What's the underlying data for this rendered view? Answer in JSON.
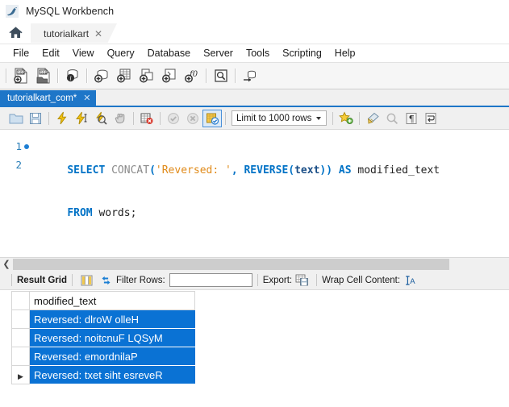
{
  "window": {
    "title": "MySQL Workbench",
    "logo_icon": "mysql-dolphin-icon"
  },
  "connection_tabs": {
    "home_icon": "home-icon",
    "tabs": [
      {
        "label": "tutorialkart",
        "close_icon": "close-icon"
      }
    ]
  },
  "menubar": {
    "items": [
      "File",
      "Edit",
      "View",
      "Query",
      "Database",
      "Server",
      "Tools",
      "Scripting",
      "Help"
    ]
  },
  "main_toolbar": {
    "buttons": [
      {
        "name": "new-sql-tab-icon",
        "glyph": "SQL"
      },
      {
        "name": "open-sql-script-icon",
        "glyph": "SQL"
      },
      {
        "name": "connection-info-icon",
        "glyph": "i"
      },
      {
        "name": "create-schema-icon",
        "glyph": "+"
      },
      {
        "name": "create-table-icon",
        "glyph": "+"
      },
      {
        "name": "create-view-icon",
        "glyph": "+"
      },
      {
        "name": "create-procedure-icon",
        "glyph": "+"
      },
      {
        "name": "create-function-icon",
        "glyph": "f0"
      },
      {
        "name": "search-data-icon",
        "glyph": "Q"
      },
      {
        "name": "reconnect-server-icon",
        "glyph": "~"
      }
    ]
  },
  "editor_tabs": {
    "tabs": [
      {
        "label": "tutorialkart_com*",
        "close_icon": "close-icon",
        "active": true
      }
    ]
  },
  "editor_toolbar": {
    "buttons": [
      {
        "name": "open-file-icon"
      },
      {
        "name": "save-file-icon"
      },
      {
        "name": "execute-statement-icon"
      },
      {
        "name": "execute-current-statement-icon"
      },
      {
        "name": "explain-statement-icon"
      },
      {
        "name": "stop-execution-icon"
      },
      {
        "name": "toggle-stop-on-error-icon"
      },
      {
        "name": "commit-transaction-icon"
      },
      {
        "name": "rollback-transaction-icon"
      },
      {
        "name": "toggle-auto-commit-icon"
      }
    ],
    "limit_dropdown": {
      "value": "Limit to 1000 rows",
      "caret_icon": "chevron-down-icon"
    },
    "right_buttons": [
      {
        "name": "save-snippet-icon"
      },
      {
        "name": "beautify-query-icon"
      },
      {
        "name": "find-icon"
      },
      {
        "name": "toggle-invisible-chars-icon"
      },
      {
        "name": "toggle-word-wrap-icon"
      }
    ]
  },
  "editor": {
    "lines": [
      {
        "number": "1",
        "has_breakpoint_dot": true,
        "tokens": [
          {
            "text": "    ",
            "type": "plain"
          },
          {
            "text": "SELECT",
            "type": "keyword"
          },
          {
            "text": " ",
            "type": "plain"
          },
          {
            "text": "CONCAT",
            "type": "function"
          },
          {
            "text": "(",
            "type": "punctuation"
          },
          {
            "text": "'Reversed: '",
            "type": "string"
          },
          {
            "text": ",",
            "type": "punctuation"
          },
          {
            "text": " ",
            "type": "plain"
          },
          {
            "text": "REVERSE",
            "type": "keyword"
          },
          {
            "text": "(",
            "type": "punctuation"
          },
          {
            "text": "text",
            "type": "column"
          },
          {
            "text": "))",
            "type": "punctuation"
          },
          {
            "text": " ",
            "type": "plain"
          },
          {
            "text": "AS",
            "type": "keyword"
          },
          {
            "text": " ",
            "type": "plain"
          },
          {
            "text": "modified_text",
            "type": "identifier"
          }
        ]
      },
      {
        "number": "2",
        "has_breakpoint_dot": false,
        "tokens": [
          {
            "text": "    ",
            "type": "plain"
          },
          {
            "text": "FROM",
            "type": "keyword"
          },
          {
            "text": " ",
            "type": "plain"
          },
          {
            "text": "words;",
            "type": "identifier"
          }
        ]
      }
    ]
  },
  "editor_scrollbar": {
    "left_arrow_icon": "chevron-left-icon"
  },
  "results_toolbar": {
    "result_grid_label": "Result Grid",
    "grid_view_icon": "grid-view-icon",
    "refresh_icon": "refresh-icon",
    "filter_label": "Filter Rows:",
    "filter_value": "",
    "filter_placeholder": "",
    "export_label": "Export:",
    "export_icon": "export-recordset-icon",
    "wrap_label": "Wrap Cell Content:",
    "wrap_icon": "wrap-cell-content-icon"
  },
  "result_grid": {
    "columns": [
      "modified_text"
    ],
    "rows": [
      {
        "marker": "",
        "modified_text": "Reversed: dlroW olleH",
        "selected": true
      },
      {
        "marker": "",
        "modified_text": "Reversed: noitcnuF LQSyM",
        "selected": true
      },
      {
        "marker": "",
        "modified_text": "Reversed: emordnilaP",
        "selected": true
      },
      {
        "marker": "▶",
        "modified_text": "Reversed: txet siht esreveR",
        "selected": true
      }
    ]
  },
  "colors": {
    "accent_blue": "#1e76c8",
    "selection_blue": "#0a72d4",
    "keyword": "#0072c6",
    "string": "#e08a19",
    "function_gray": "#8a8a8a",
    "column_blue": "#1b4f87",
    "toolbar_bg": "#f0f0f0"
  }
}
